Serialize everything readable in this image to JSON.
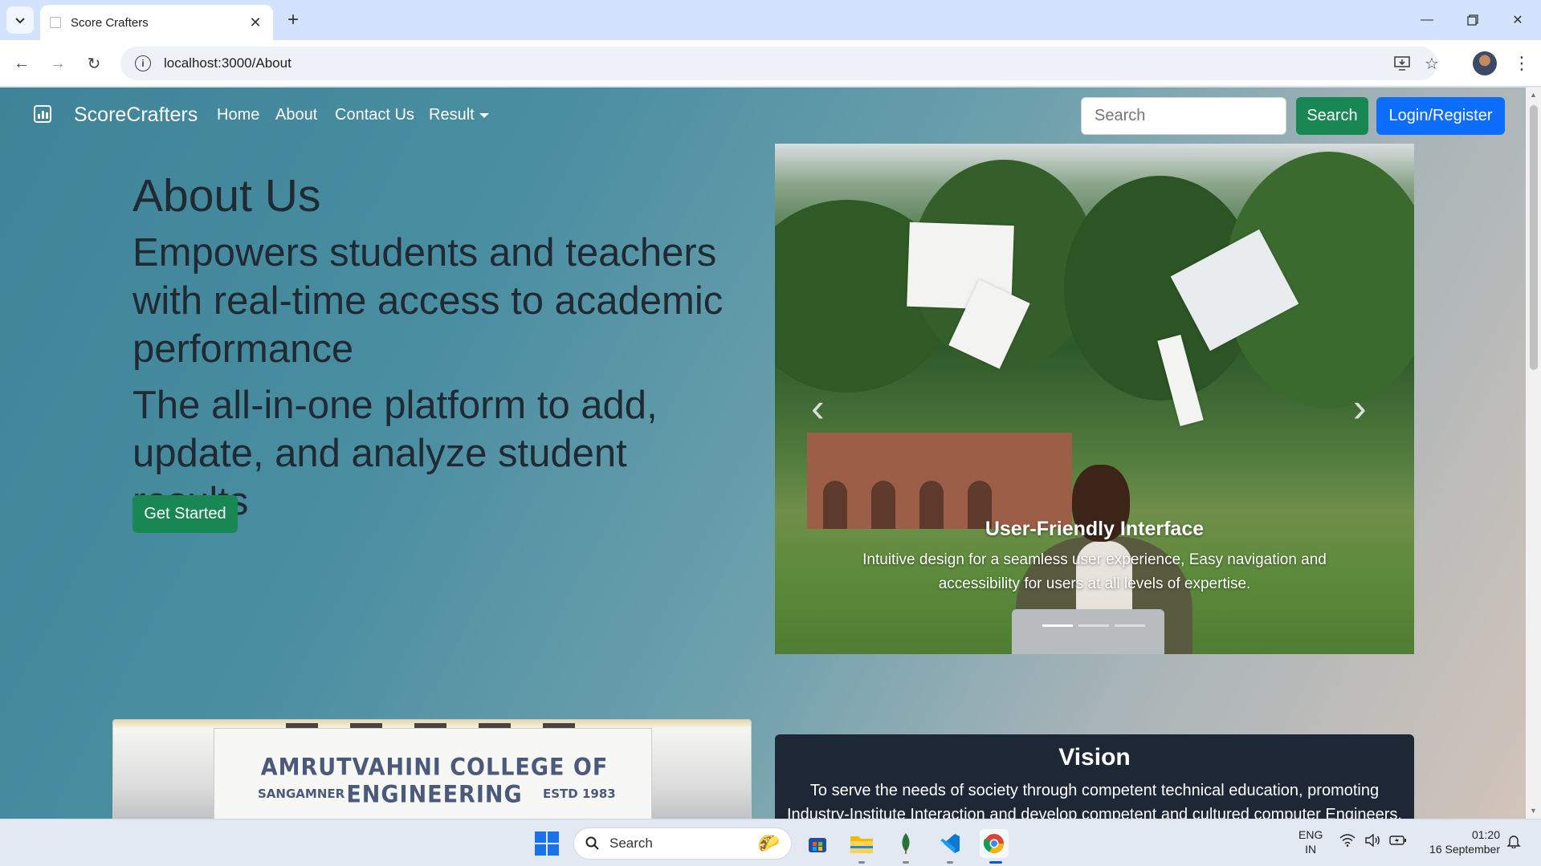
{
  "browser": {
    "tab_title": "Score Crafters",
    "new_tab_label": "+",
    "url": "localhost:3000/About"
  },
  "navbar": {
    "brand": "ScoreCrafters",
    "links": {
      "home": "Home",
      "about": "About",
      "contact": "Contact Us",
      "result": "Result"
    },
    "search_placeholder": "Search",
    "search_button": "Search",
    "login_button": "Login/Register"
  },
  "hero": {
    "title": "About Us",
    "lead1": "Empowers students and teachers with real-time access to academic performance",
    "lead2": "The all-in-one platform to add, update, and analyze student results",
    "cta": "Get Started"
  },
  "carousel": {
    "caption_title": "User-Friendly Interface",
    "caption_text": "Intuitive design for a seamless user experience, Easy navigation and accessibility for users at all levels of expertise.",
    "slide_count": 3,
    "active_index": 0
  },
  "college": {
    "sign": "AMRUTVAHINI COLLEGE OF ENGINEERING",
    "location": "SANGAMNER",
    "estd": "ESTD 1983"
  },
  "vision": {
    "title": "Vision",
    "text": "To serve the needs of society through competent technical education, promoting Industry-Institute Interaction and develop competent and cultured computer Engineers."
  },
  "taskbar": {
    "search_label": "Search",
    "lang_top": "ENG",
    "lang_bottom": "IN",
    "time": "01:20",
    "date": "16 September"
  },
  "colors": {
    "success": "#198754",
    "primary": "#0d6efd",
    "vision_bg": "#1e2735"
  }
}
